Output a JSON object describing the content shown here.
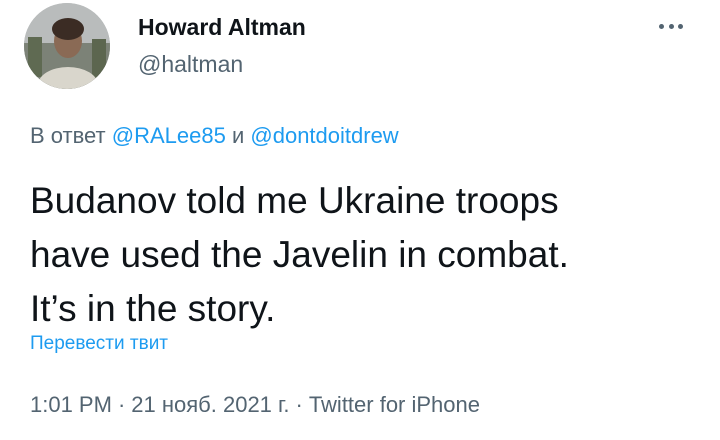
{
  "author": {
    "name": "Howard Altman",
    "handle": "@haltman"
  },
  "reply": {
    "prefix": "В ответ",
    "user1": "@RALee85",
    "conj": "и",
    "user2": "@dontdoitdrew"
  },
  "tweet": {
    "lines": [
      "Budanov told me Ukraine troops",
      "have used the Javelin in combat.",
      "It’s in the story."
    ],
    "translate_label": "Перевести твит"
  },
  "meta": {
    "time": "1:01 PM",
    "date": "21 нояб. 2021 г.",
    "source": "Twitter for iPhone",
    "separator": "·"
  },
  "colors": {
    "link": "#1d9bf0",
    "secondary_text": "#536471",
    "primary_text": "#0f1419"
  },
  "icons": {
    "more": "more-horizontal-icon"
  }
}
